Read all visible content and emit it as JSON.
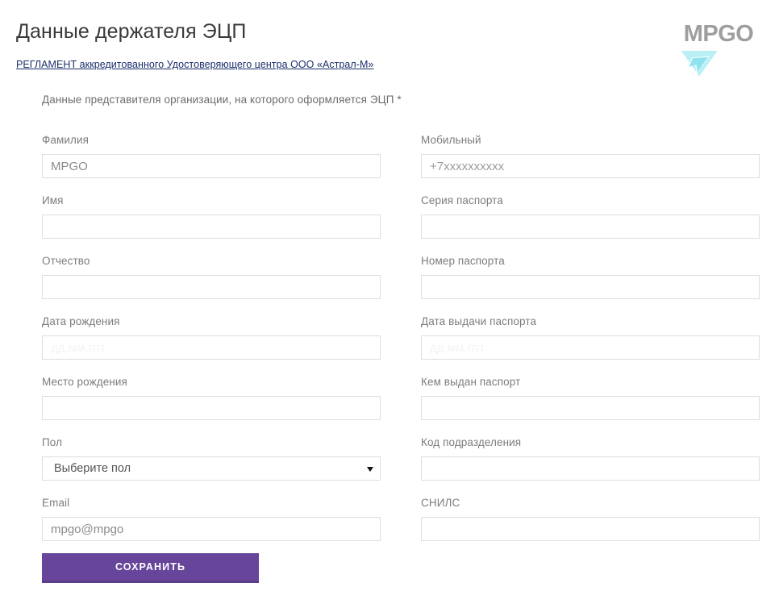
{
  "header": {
    "title": "Данные держателя ЭЦП",
    "reglament_link": "РЕГЛАМЕНТ аккредитованного Удостоверяющего центра ООО «Астрал-М»",
    "section_note": "Данные представителя организации, на которого оформляется ЭЦП",
    "required_marker": "*"
  },
  "logo": {
    "text": "MPGO",
    "mark_icon": "triangle-arrow-icon",
    "text_color": "#9e9e9e",
    "mark_color": "#b9f0f5"
  },
  "colors": {
    "accent_purple": "#66459a",
    "accent_purple_shadow": "#5b3d8b",
    "link_blue": "#1a2f6b",
    "label_gray": "#7c7c7c",
    "border_gray": "#dededc"
  },
  "form": {
    "left_column": [
      {
        "name": "surname",
        "label": "Фамилия",
        "type": "text",
        "value": "MPGO",
        "placeholder": "",
        "ghost": false
      },
      {
        "name": "firstname",
        "label": "Имя",
        "type": "text",
        "value": "",
        "placeholder": "",
        "ghost": false
      },
      {
        "name": "patronymic",
        "label": "Отчество",
        "type": "text",
        "value": "",
        "placeholder": "",
        "ghost": false
      },
      {
        "name": "birth-date",
        "label": "Дата рождения",
        "type": "text",
        "value": "",
        "placeholder": "дд.мм.гггг",
        "ghost": true
      },
      {
        "name": "birth-place",
        "label": "Место рождения",
        "type": "text",
        "value": "",
        "placeholder": "",
        "ghost": false
      },
      {
        "name": "gender",
        "label": "Пол",
        "type": "select",
        "value": "Выберите пол",
        "options": [
          "Выберите пол"
        ],
        "ghost": false
      },
      {
        "name": "email",
        "label": "Email",
        "type": "text",
        "value": "mpgo@mpgo",
        "placeholder": "",
        "ghost": false
      }
    ],
    "right_column": [
      {
        "name": "mobile",
        "label": "Мобильный",
        "type": "text",
        "value": "",
        "placeholder": "+7xxxxxxxxxx",
        "ghost": false
      },
      {
        "name": "passport-series",
        "label": "Серия паспорта",
        "type": "text",
        "value": "",
        "placeholder": "",
        "ghost": false
      },
      {
        "name": "passport-number",
        "label": "Номер паспорта",
        "type": "text",
        "value": "",
        "placeholder": "",
        "ghost": false
      },
      {
        "name": "passport-issue-date",
        "label": "Дата выдачи паспорта",
        "type": "text",
        "value": "",
        "placeholder": "дд.мм.гггг",
        "ghost": true
      },
      {
        "name": "passport-issued-by",
        "label": "Кем выдан паспорт",
        "type": "text",
        "value": "",
        "placeholder": "",
        "ghost": false
      },
      {
        "name": "department-code",
        "label": "Код подразделения",
        "type": "text",
        "value": "",
        "placeholder": "",
        "ghost": false
      },
      {
        "name": "snils",
        "label": "СНИЛС",
        "type": "text",
        "value": "",
        "placeholder": "",
        "ghost": false
      }
    ]
  },
  "actions": {
    "save_label": "СОХРАНИТЬ"
  }
}
